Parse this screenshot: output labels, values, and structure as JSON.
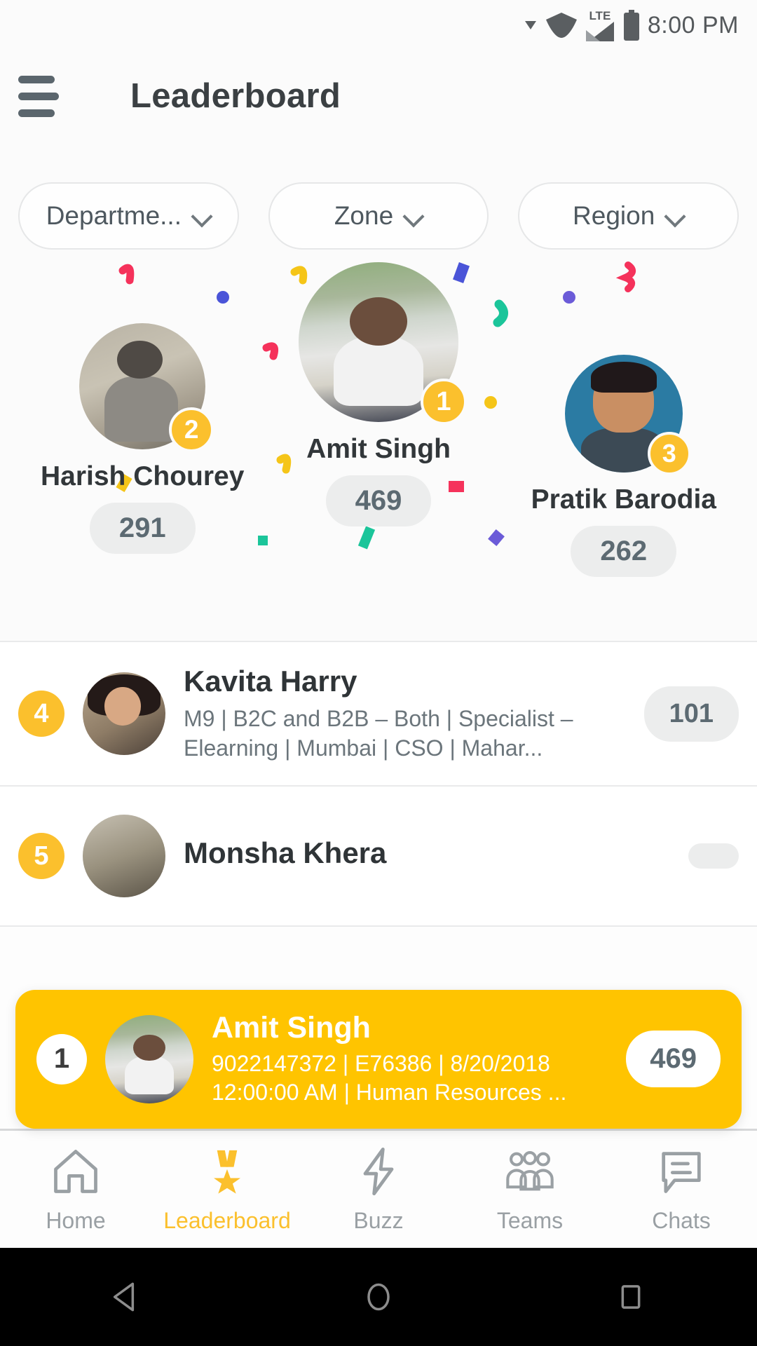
{
  "status_bar": {
    "time": "8:00 PM",
    "network": "LTE",
    "icons": [
      "dropdown-arrow-icon",
      "wifi-icon",
      "signal-icon",
      "battery-icon"
    ]
  },
  "app_bar": {
    "title": "Leaderboard",
    "menu_icon": "hamburger-menu-icon"
  },
  "filters": [
    {
      "label": "Departme...",
      "icon": "chevron-down-icon"
    },
    {
      "label": "Zone",
      "icon": "chevron-down-icon"
    },
    {
      "label": "Region",
      "icon": "chevron-down-icon"
    }
  ],
  "podium": {
    "first": {
      "rank": "1",
      "name": "Amit Singh",
      "score": "469"
    },
    "second": {
      "rank": "2",
      "name": "Harish Chourey",
      "score": "291"
    },
    "third": {
      "rank": "3",
      "name": "Pratik Barodia",
      "score": "262"
    }
  },
  "list": [
    {
      "rank": "4",
      "name": "Kavita Harry",
      "meta": "M9 | B2C and B2B – Both | Specialist – Elearning | Mumbai | CSO | Mahar...",
      "score": "101"
    },
    {
      "rank": "5",
      "name": "Monsha Khera",
      "meta": "",
      "score": ""
    }
  ],
  "sticky_card": {
    "rank": "1",
    "name": "Amit Singh",
    "meta": "9022147372 | E76386 | 8/20/2018 12:00:00 AM | Human Resources ...",
    "score": "469",
    "background_color": "#ffc400"
  },
  "bottom_nav": [
    {
      "label": "Home",
      "icon": "home-icon",
      "active": false
    },
    {
      "label": "Leaderboard",
      "icon": "medal-icon",
      "active": true
    },
    {
      "label": "Buzz",
      "icon": "lightning-icon",
      "active": false
    },
    {
      "label": "Teams",
      "icon": "people-group-icon",
      "active": false
    },
    {
      "label": "Chats",
      "icon": "chat-bubble-icon",
      "active": false
    }
  ],
  "system_nav": [
    {
      "icon": "back-triangle-icon"
    },
    {
      "icon": "home-circle-icon"
    },
    {
      "icon": "recents-square-icon"
    }
  ],
  "colors": {
    "accent": "#fbc02d",
    "highlight": "#ffc400",
    "pill": "#eceded",
    "text": "#32373a"
  }
}
